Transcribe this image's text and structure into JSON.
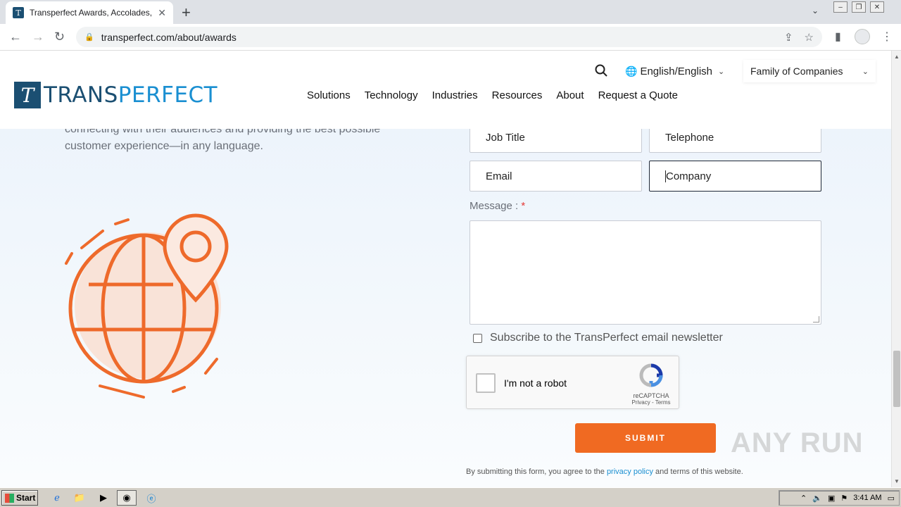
{
  "browser": {
    "tab_title": "Transperfect Awards, Accolades, an",
    "tab_favicon": "T",
    "url": "transperfect.com/about/awards"
  },
  "site": {
    "logo_letter": "T",
    "logo_part1": "TRANS",
    "logo_part2": "PERFECT",
    "language": "English/English",
    "family": "Family of Companies",
    "nav": [
      "Solutions",
      "Technology",
      "Industries",
      "Resources",
      "About",
      "Request a Quote"
    ]
  },
  "intro": {
    "text": "connecting with their audiences and providing the best possible customer experience—in any language."
  },
  "form": {
    "job_title": "Job Title",
    "telephone": "Telephone",
    "email": "Email",
    "company": "Company",
    "message_label": "Message :",
    "required_mark": "*",
    "newsletter": "Subscribe to the TransPerfect email newsletter",
    "captcha_text": "I'm not a robot",
    "captcha_brand": "reCAPTCHA",
    "captcha_links": "Privacy - Terms",
    "submit": "SUBMIT",
    "disclaimer_pre": "By submitting this form, you agree to the ",
    "disclaimer_link": "privacy policy",
    "disclaimer_post": " and terms of this website."
  },
  "watermark": "ANY RUN",
  "taskbar": {
    "start": "Start",
    "time": "3:41 AM"
  },
  "colors": {
    "accent": "#f06a22",
    "brand_dark": "#1b4f72",
    "brand_light": "#1a8fd1"
  }
}
